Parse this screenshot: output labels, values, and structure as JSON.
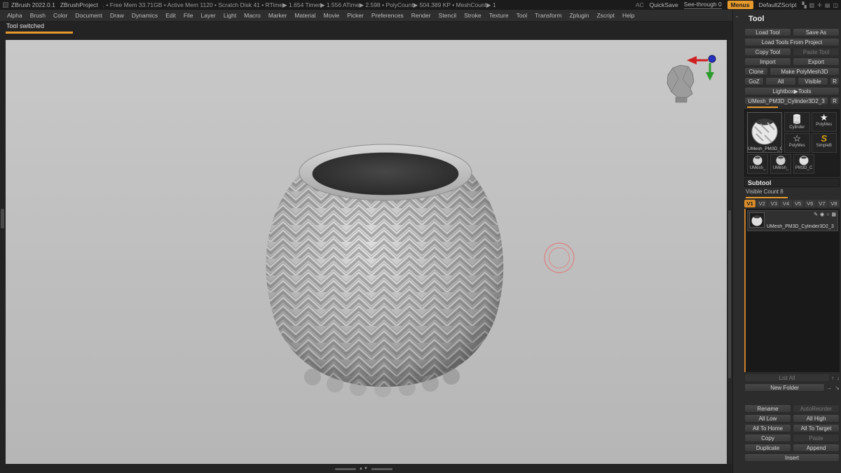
{
  "titlebar": {
    "app_title": "ZBrush 2022.0.1",
    "project": "ZBrushProject",
    "stats": ". • Free Mem 33.71GB • Active Mem 1120 • Scratch Disk 41 • RTime▶ 1.654 Timer▶ 1.556 ATime▶ 2.598 • PolyCount▶ 504.389 KP • MeshCount▶ 1",
    "ac": "AC",
    "quicksave": "QuickSave",
    "see_through": "See-through  0",
    "menus": "Menus",
    "zscript": "DefaultZScript"
  },
  "menubar": {
    "items": [
      "Alpha",
      "Brush",
      "Color",
      "Document",
      "Draw",
      "Dynamics",
      "Edit",
      "File",
      "Layer",
      "Light",
      "Macro",
      "Marker",
      "Material",
      "Movie",
      "Picker",
      "Preferences",
      "Render",
      "Stencil",
      "Stroke",
      "Texture",
      "Tool",
      "Transform",
      "Zplugin",
      "Zscript",
      "Help"
    ]
  },
  "status": {
    "message": "Tool switched"
  },
  "tool_panel": {
    "title": "Tool",
    "load_tool": "Load Tool",
    "save_as": "Save As",
    "load_tools_from_project": "Load Tools From Project",
    "copy_tool": "Copy Tool",
    "paste_tool": "Paste Tool",
    "import_btn": "Import",
    "export_btn": "Export",
    "clone": "Clone",
    "make_polymesh3d": "Make PolyMesh3D",
    "goz": "GoZ",
    "all": "All",
    "visible": "Visible",
    "r": "R",
    "lightbox_tools": "Lightbox▶Tools",
    "current_tool": "UMesh_PM3D_Cylinder3D2_3",
    "current_tool_r": "R",
    "thumbs": {
      "selected_label": "UMesh_PM3D_C",
      "small_0": "Cylinder",
      "small_1": "PolyMes",
      "small_2": "PolyMes",
      "small_3": "SimpleB",
      "row2_0": "UMesh_",
      "row2_1": "UMesh_",
      "row2_2": "PM3D_C"
    }
  },
  "subtool": {
    "title": "Subtool",
    "visible_count": "Visible Count 8",
    "tabs": [
      "V1",
      "V2",
      "V3",
      "V4",
      "V5",
      "V6",
      "V7",
      "V8"
    ],
    "item_name": "UMesh_PM3D_Cylinder3D2_3",
    "list_all": "List All",
    "new_folder": "New Folder",
    "rename": "Rename",
    "auto_reorder": "AutoReorder",
    "all_low": "All Low",
    "all_high": "All High",
    "all_to_home": "All To Home",
    "all_to_target": "All To Target",
    "copy": "Copy",
    "paste": "Paste",
    "duplicate": "Duplicate",
    "append": "Append",
    "insert": "Insert"
  },
  "colors": {
    "accent": "#e59a2c",
    "canvas": "#c2c2c2"
  }
}
